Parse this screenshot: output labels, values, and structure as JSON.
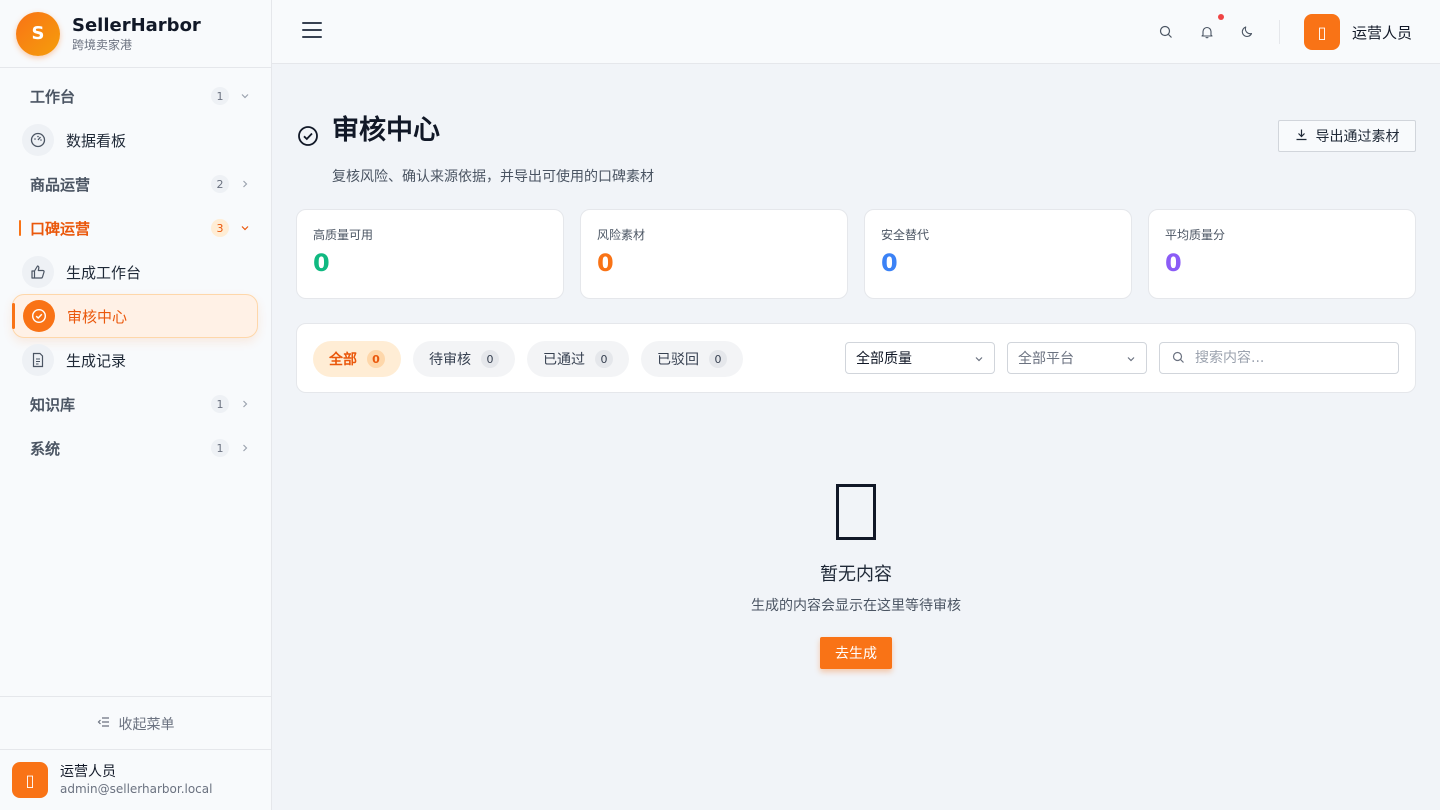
{
  "brand": {
    "logo_letter": "S",
    "name": "SellerHarbor",
    "subtitle": "跨境卖家港"
  },
  "sidebar": {
    "groups": [
      {
        "label": "工作台",
        "count": "1",
        "expanded": true,
        "items": [
          {
            "label": "数据看板",
            "icon": "dashboard-gauge-icon"
          }
        ]
      },
      {
        "label": "商品运营",
        "count": "2",
        "expanded": false
      },
      {
        "label": "口碑运营",
        "count": "3",
        "expanded": true,
        "active": true,
        "items": [
          {
            "label": "生成工作台",
            "icon": "thumbs-up-icon"
          },
          {
            "label": "审核中心",
            "icon": "check-circle-icon",
            "active": true
          },
          {
            "label": "生成记录",
            "icon": "document-icon"
          }
        ]
      },
      {
        "label": "知识库",
        "count": "1",
        "expanded": false
      },
      {
        "label": "系统",
        "count": "1",
        "expanded": false
      }
    ],
    "collapse_label": "收起菜单",
    "user": {
      "name": "运营人员",
      "email": "admin@sellerharbor.local",
      "avatar_glyph": "▯"
    }
  },
  "header": {
    "user_name": "运营人员",
    "avatar_glyph": "▯",
    "notification_dot": true
  },
  "page": {
    "title": "审核中心",
    "subtitle": "复核风险、确认来源依据，并导出可使用的口碑素材",
    "export_label": "导出通过素材"
  },
  "stats": [
    {
      "label": "高质量可用",
      "value": "0",
      "color": "#10b981"
    },
    {
      "label": "风险素材",
      "value": "0",
      "color": "#f97316"
    },
    {
      "label": "安全替代",
      "value": "0",
      "color": "#3b82f6"
    },
    {
      "label": "平均质量分",
      "value": "0",
      "color": "#8b5cf6"
    }
  ],
  "filters": {
    "chips": [
      {
        "label": "全部",
        "count": "0",
        "active": true
      },
      {
        "label": "待审核",
        "count": "0"
      },
      {
        "label": "已通过",
        "count": "0"
      },
      {
        "label": "已驳回",
        "count": "0"
      }
    ],
    "quality_select": "全部质量",
    "platform_select": "全部平台",
    "search_placeholder": "搜索内容..."
  },
  "empty": {
    "title": "暂无内容",
    "description": "生成的内容会显示在这里等待审核",
    "button_label": "去生成"
  },
  "colors": {
    "accent": "#f97316",
    "accent_bg": "#ffedd5"
  }
}
